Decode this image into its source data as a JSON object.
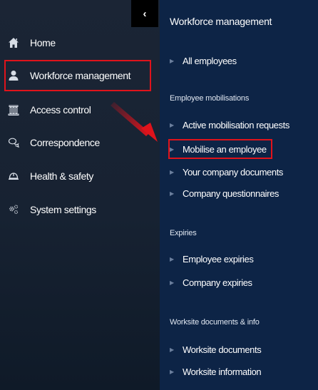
{
  "sidebar": {
    "collapse_glyph": "‹",
    "items": [
      {
        "label": "Home",
        "icon": "home-icon"
      },
      {
        "label": "Workforce management",
        "icon": "user-icon"
      },
      {
        "label": "Access control",
        "icon": "building-icon"
      },
      {
        "label": "Correspondence",
        "icon": "chat-icon"
      },
      {
        "label": "Health & safety",
        "icon": "helmet-icon"
      },
      {
        "label": "System settings",
        "icon": "gears-icon"
      }
    ]
  },
  "submenu": {
    "title": "Workforce management",
    "groups": [
      {
        "heading": "",
        "items": [
          "All employees"
        ]
      },
      {
        "heading": "Employee mobilisations",
        "items": [
          "Active mobilisation requests",
          "Mobilise an employee",
          "Your company documents",
          "Company questionnaires"
        ]
      },
      {
        "heading": "Expiries",
        "items": [
          "Employee expiries",
          "Company expiries"
        ]
      },
      {
        "heading": "Worksite documents & info",
        "items": [
          "Worksite documents",
          "Worksite information"
        ]
      }
    ]
  },
  "colors": {
    "left_bg": "#172232",
    "right_bg": "#0d2446",
    "highlight": "#e0131b"
  }
}
